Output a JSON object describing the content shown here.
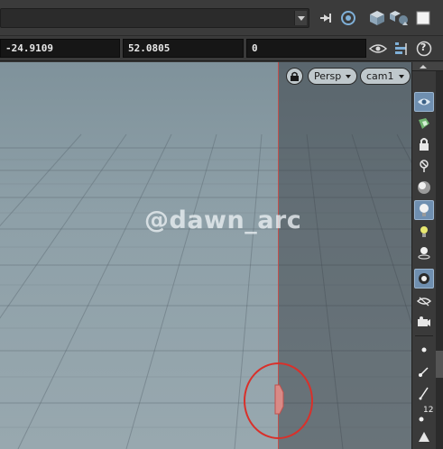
{
  "toolbar": {
    "path_combo_value": "",
    "icons": [
      "pin-icon",
      "target-icon",
      "cube-view-icon",
      "scene-cam-icon",
      "white-square-icon"
    ]
  },
  "coords": {
    "x": "-24.9109",
    "y": "52.0805",
    "z": "0",
    "icons": [
      "eye-visibility-icon",
      "stack-icon",
      "help-icon"
    ],
    "help_glyph": "?"
  },
  "viewport": {
    "view_mode_label": "Persp",
    "camera_label": "cam1",
    "watermark": "@dawn_arc",
    "colors": {
      "background": "#8ea0a8",
      "line": "#c0504d",
      "highlight_circle": "#d9302a"
    }
  },
  "shelf": {
    "icons": [
      "display-options-icon",
      "ghost-icon",
      "lock-icon",
      "xray-icon",
      "shading-sphere-icon",
      "light-bulb-icon",
      "headlight-icon",
      "point-light-icon",
      "snapshot-icon",
      "visibility-eye-icon",
      "camera-icon",
      "point-icon",
      "vector-icon",
      "brush-icon",
      "numbered-points-icon",
      "geometry-icon"
    ],
    "points_label": "12"
  }
}
